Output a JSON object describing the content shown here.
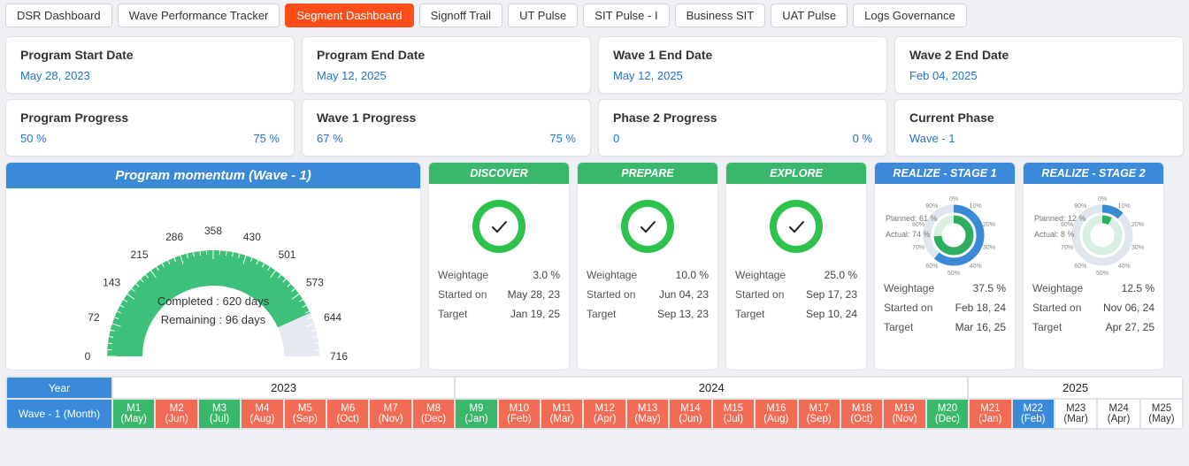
{
  "tabs": [
    "DSR Dashboard",
    "Wave Performance Tracker",
    "Segment Dashboard",
    "Signoff Trail",
    "UT Pulse",
    "SIT Pulse - I",
    "Business SIT",
    "UAT Pulse",
    "Logs Governance"
  ],
  "active_tab_index": 2,
  "cards_top": [
    {
      "title": "Program Start Date",
      "value": "May 28, 2023"
    },
    {
      "title": "Program End Date",
      "value": "May 12, 2025"
    },
    {
      "title": "Wave 1 End Date",
      "value": "May 12, 2025"
    },
    {
      "title": "Wave 2 End Date",
      "value": "Feb 04, 2025"
    }
  ],
  "cards_bottom": [
    {
      "title": "Program Progress",
      "value": "50 %",
      "value2": "75 %"
    },
    {
      "title": "Wave 1 Progress",
      "value": "67 %",
      "value2": "75 %"
    },
    {
      "title": "Phase 2 Progress",
      "value": "0",
      "value2": "0 %"
    },
    {
      "title": "Current Phase",
      "value": "Wave - 1"
    }
  ],
  "momentum": {
    "title": "Program momentum (Wave - 1)",
    "completed_label": "Completed : 620 days",
    "remaining_label": "Remaining : 96 days",
    "ticks": [
      "0",
      "72",
      "143",
      "215",
      "286",
      "358",
      "430",
      "501",
      "573",
      "644",
      "716"
    ],
    "completed_days": 620,
    "total_days": 716
  },
  "stages": [
    {
      "name": "DISCOVER",
      "status": "done",
      "weightage": "3.0 %",
      "started": "May 28, 23",
      "target": "Jan 19, 25"
    },
    {
      "name": "PREPARE",
      "status": "done",
      "weightage": "10.0 %",
      "started": "Jun 04, 23",
      "target": "Sep 13, 23"
    },
    {
      "name": "EXPLORE",
      "status": "done",
      "weightage": "25.0 %",
      "started": "Sep 17, 23",
      "target": "Sep 10, 24"
    },
    {
      "name": "REALIZE - STAGE 1",
      "status": "progress",
      "planned": "61 %",
      "actual": "74 %",
      "weightage": "37.5 %",
      "started": "Feb 18, 24",
      "target": "Mar 16, 25"
    },
    {
      "name": "REALIZE - STAGE 2",
      "status": "progress",
      "planned": "12 %",
      "actual": "8 %",
      "weightage": "12.5 %",
      "started": "Nov 06, 24",
      "target": "Apr 27, 25"
    }
  ],
  "stage_labels": {
    "weightage": "Weightage",
    "started": "Started on",
    "target": "Target",
    "planned_prefix": "Planned: ",
    "actual_prefix": "Actual: "
  },
  "radial_ticks": [
    "0%",
    "10%",
    "20%",
    "30%",
    "40%",
    "50%",
    "60%",
    "70%",
    "80%",
    "90%"
  ],
  "timeline": {
    "head_year": "Year",
    "head_wave": "Wave - 1 (Month)",
    "years": [
      {
        "label": "2023",
        "span": 8
      },
      {
        "label": "2024",
        "span": 12
      },
      {
        "label": "2025",
        "span": 5
      }
    ],
    "months": [
      {
        "m": "M1",
        "mon": "(May)",
        "c": "green"
      },
      {
        "m": "M2",
        "mon": "(Jun)",
        "c": "red"
      },
      {
        "m": "M3",
        "mon": "(Jul)",
        "c": "green"
      },
      {
        "m": "M4",
        "mon": "(Aug)",
        "c": "red"
      },
      {
        "m": "M5",
        "mon": "(Sep)",
        "c": "red"
      },
      {
        "m": "M6",
        "mon": "(Oct)",
        "c": "red"
      },
      {
        "m": "M7",
        "mon": "(Nov)",
        "c": "red"
      },
      {
        "m": "M8",
        "mon": "(Dec)",
        "c": "red"
      },
      {
        "m": "M9",
        "mon": "(Jan)",
        "c": "green"
      },
      {
        "m": "M10",
        "mon": "(Feb)",
        "c": "red"
      },
      {
        "m": "M11",
        "mon": "(Mar)",
        "c": "red"
      },
      {
        "m": "M12",
        "mon": "(Apr)",
        "c": "red"
      },
      {
        "m": "M13",
        "mon": "(May)",
        "c": "red"
      },
      {
        "m": "M14",
        "mon": "(Jun)",
        "c": "red"
      },
      {
        "m": "M15",
        "mon": "(Jul)",
        "c": "red"
      },
      {
        "m": "M16",
        "mon": "(Aug)",
        "c": "red"
      },
      {
        "m": "M17",
        "mon": "(Sep)",
        "c": "red"
      },
      {
        "m": "M18",
        "mon": "(Oct)",
        "c": "red"
      },
      {
        "m": "M19",
        "mon": "(Nov)",
        "c": "red"
      },
      {
        "m": "M20",
        "mon": "(Dec)",
        "c": "green"
      },
      {
        "m": "M21",
        "mon": "(Jan)",
        "c": "red"
      },
      {
        "m": "M22",
        "mon": "(Feb)",
        "c": "blue"
      },
      {
        "m": "M23",
        "mon": "(Mar)",
        "c": "plain"
      },
      {
        "m": "M24",
        "mon": "(Apr)",
        "c": "plain"
      },
      {
        "m": "M25",
        "mon": "(May)",
        "c": "plain"
      }
    ]
  },
  "chart_data": [
    {
      "type": "bar",
      "title": "Program momentum (Wave - 1)",
      "categories": [
        "Completed",
        "Remaining"
      ],
      "values": [
        620,
        96
      ],
      "ylim": [
        0,
        716
      ],
      "xlabel": "",
      "ylabel": "days"
    },
    {
      "type": "pie",
      "title": "REALIZE - STAGE 1",
      "series": [
        {
          "name": "Planned",
          "values": [
            61,
            39
          ]
        },
        {
          "name": "Actual",
          "values": [
            74,
            26
          ]
        }
      ],
      "legend": [
        "Planned %",
        "Actual %"
      ]
    },
    {
      "type": "pie",
      "title": "REALIZE - STAGE 2",
      "series": [
        {
          "name": "Planned",
          "values": [
            12,
            88
          ]
        },
        {
          "name": "Actual",
          "values": [
            8,
            92
          ]
        }
      ],
      "legend": [
        "Planned %",
        "Actual %"
      ]
    }
  ]
}
